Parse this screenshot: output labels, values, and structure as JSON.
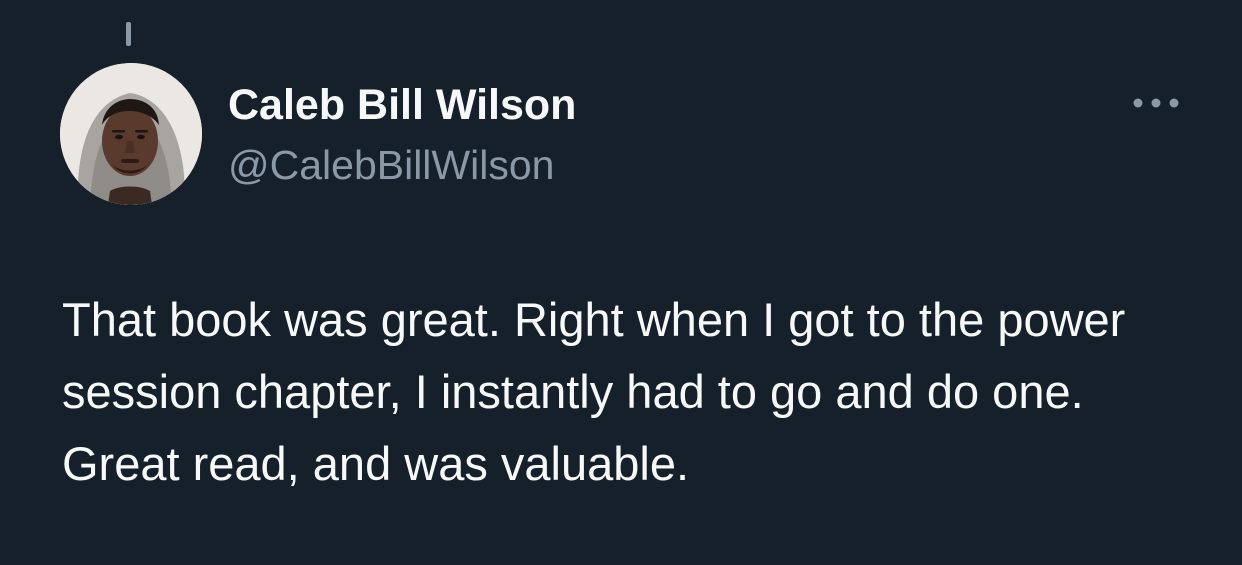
{
  "tweet": {
    "author": {
      "display_name": "Caleb Bill Wilson",
      "handle": "@CalebBillWilson",
      "avatar": "profile-photo"
    },
    "more_icon": "more-horizontal-icon",
    "text": "That book was great. Right when I got to the power session chapter, I instantly had to go and do one. Great read, and was valuable."
  },
  "colors": {
    "background": "#15202b",
    "primary_text": "#f7f9f9",
    "secondary_text": "#8b98a5"
  }
}
